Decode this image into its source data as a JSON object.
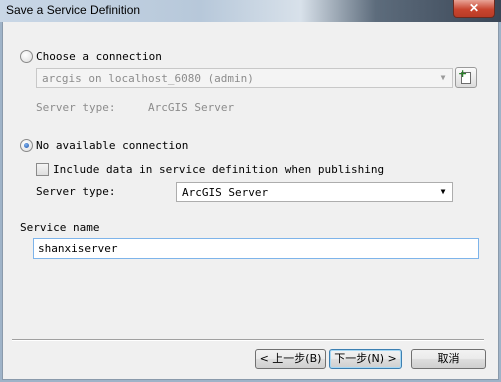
{
  "window": {
    "title": "Save a Service Definition",
    "close_glyph": "✕"
  },
  "connection_option": {
    "label": "Choose a connection",
    "selected": false,
    "connection_value": "arcgis on localhost_6080 (admin)",
    "server_type_label": "Server type:",
    "server_type_value": "ArcGIS Server",
    "add_button_icon": "add-connection-icon"
  },
  "no_connection_option": {
    "label": "No available connection",
    "selected": true,
    "include_data_label": "Include data in service definition when publishing",
    "include_data_checked": false,
    "server_type_label": "Server type:",
    "server_type_value": "ArcGIS Server"
  },
  "service_name": {
    "label": "Service name",
    "value": "shanxiserver"
  },
  "buttons": {
    "back": "< 上一步(B)",
    "next": "下一步(N) >",
    "cancel": "取消"
  }
}
